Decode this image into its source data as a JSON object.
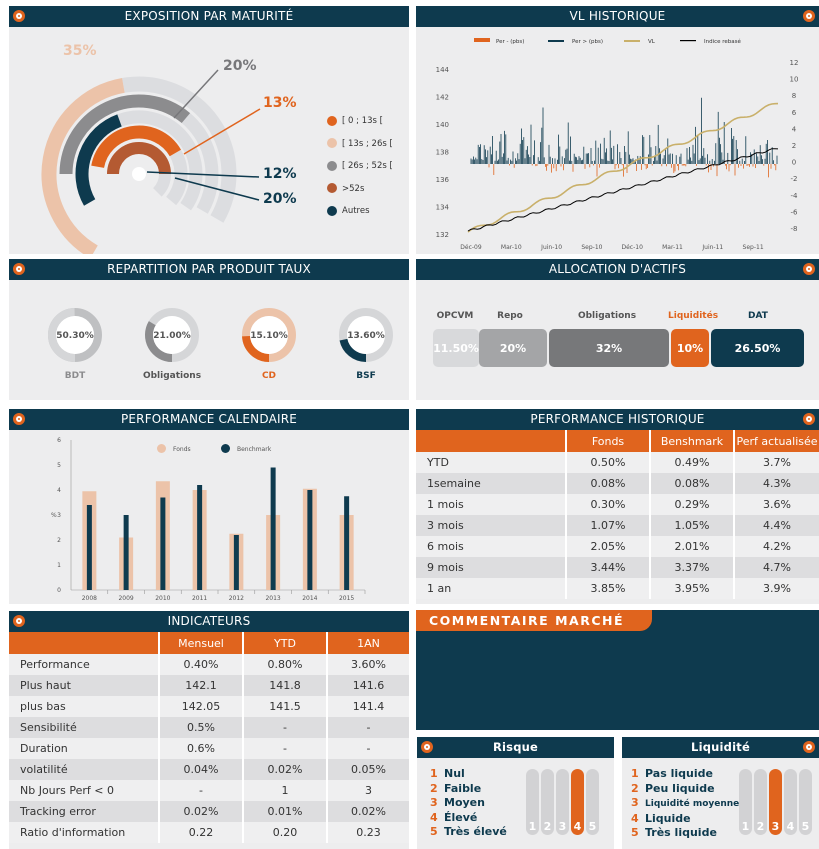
{
  "colors": {
    "navy": "#0e3a4e",
    "orange": "#e0641e",
    "peach": "#ecc3a9",
    "gray": "#8c8c8e",
    "lightgray": "#d5d6d8",
    "brown": "#b45a32"
  },
  "maturite": {
    "title": "EXPOSITION PAR MATURITÉ",
    "labels": [
      "35%",
      "20%",
      "13%",
      "12%",
      "20%"
    ],
    "legend": [
      "[ 0 ; 13s [",
      "[ 13s ; 26s [",
      "[ 26s ; 52s [",
      ">52s",
      "Autres"
    ]
  },
  "vl": {
    "title": "VL HISTORIQUE",
    "legend": [
      "Per - (pbs)",
      "Per > (pbs)",
      "VL",
      "Indice rebasé"
    ],
    "left_ticks": [
      "144",
      "142",
      "140",
      "138",
      "136",
      "134",
      "132"
    ],
    "right_ticks": [
      "12",
      "10",
      "8",
      "6",
      "4",
      "2",
      "0",
      "-2",
      "-4",
      "-6",
      "-8"
    ],
    "x_ticks": [
      "Déc-09",
      "Mar-10",
      "Juin-10",
      "Sep-10",
      "Déc-10",
      "Mar-11",
      "Juin-11",
      "Sep-11"
    ]
  },
  "repartition": {
    "title": "REPARTITION PAR PRODUIT TAUX",
    "items": [
      {
        "value": "50.30%",
        "label": "BDT",
        "pct": 50.3
      },
      {
        "value": "21.00%",
        "label": "Obligations",
        "pct": 21.0
      },
      {
        "value": "15.10%",
        "label": "CD",
        "pct": 15.1
      },
      {
        "value": "13.60%",
        "label": "BSF",
        "pct": 13.6
      }
    ]
  },
  "allocation": {
    "title": "ALLOCATION D'ACTIFS",
    "items": [
      {
        "label": "OPCVM",
        "value": "11.50%"
      },
      {
        "label": "Repo",
        "value": "20%"
      },
      {
        "label": "Obligations",
        "value": "32%"
      },
      {
        "label": "Liquidités",
        "value": "10%"
      },
      {
        "label": "DAT",
        "value": "26.50%"
      }
    ]
  },
  "perf_cal": {
    "title": "PERFORMANCE CALENDAIRE",
    "legend": [
      "Fonds",
      "Benchmark"
    ],
    "ylabel": "%"
  },
  "chart_data": {
    "type": "bar",
    "categories": [
      "2008",
      "2009",
      "2010",
      "2011",
      "2012",
      "2013",
      "2014",
      "2015"
    ],
    "series": [
      {
        "name": "Fonds",
        "values": [
          3.95,
          2.1,
          4.35,
          4.0,
          2.25,
          3.0,
          4.05,
          3.0
        ]
      },
      {
        "name": "Benchmark",
        "values": [
          3.4,
          3.0,
          3.7,
          4.2,
          2.2,
          4.9,
          4.0,
          3.75
        ]
      }
    ],
    "ylim": [
      0,
      6
    ],
    "yticks": [
      "0",
      "1",
      "2",
      "3",
      "4",
      "5",
      "6"
    ]
  },
  "perf_hist": {
    "title": "PERFORMANCE HISTORIQUE",
    "headers": [
      "",
      "Fonds",
      "Benshmark",
      "Perf actualisée"
    ],
    "rows": [
      [
        "YTD",
        "0.50%",
        "0.49%",
        "3.7%"
      ],
      [
        "1semaine",
        "0.08%",
        "0.08%",
        "4.3%"
      ],
      [
        "1 mois",
        "0.30%",
        "0.29%",
        "3.6%"
      ],
      [
        "3 mois",
        "1.07%",
        "1.05%",
        "4.4%"
      ],
      [
        "6 mois",
        "2.05%",
        "2.01%",
        "4.2%"
      ],
      [
        "9 mois",
        "3.44%",
        "3.37%",
        "4.7%"
      ],
      [
        "1 an",
        "3.85%",
        "3.95%",
        "3.9%"
      ]
    ]
  },
  "indicateurs": {
    "title": "INDICATEURS",
    "headers": [
      "",
      "Mensuel",
      "YTD",
      "1AN"
    ],
    "rows": [
      [
        "Performance",
        "0.40%",
        "0.80%",
        "3.60%"
      ],
      [
        "Plus haut",
        "142.1",
        "141.8",
        "141.6"
      ],
      [
        "plus bas",
        "142.05",
        "141.5",
        "141.4"
      ],
      [
        "Sensibilité",
        "0.5%",
        "-",
        "-"
      ],
      [
        "Duration",
        "0.6%",
        "-",
        "-"
      ],
      [
        "volatilité",
        "0.04%",
        "0.02%",
        "0.05%"
      ],
      [
        "Nb Jours Perf < 0",
        "-",
        "1",
        "3"
      ],
      [
        "Tracking error",
        "0.02%",
        "0.01%",
        "0.02%"
      ],
      [
        "Ratio d'information",
        "0.22",
        "0.20",
        "0.23"
      ]
    ]
  },
  "commentaire": {
    "title": "COMMENTAIRE MARCHÉ"
  },
  "risque": {
    "title": "Risque",
    "items": [
      "Nul",
      "Faible",
      "Moyen",
      "Élevé",
      "Très élevé"
    ],
    "numbers": [
      "1",
      "2",
      "3",
      "4",
      "5"
    ],
    "level": 4
  },
  "liquidite": {
    "title": "Liquidité",
    "items": [
      "Pas liquide",
      "Peu liquide",
      "Liquidité moyenne",
      "Liquide",
      "Très liquide"
    ],
    "numbers": [
      "1",
      "2",
      "3",
      "4",
      "5"
    ],
    "level": 3
  }
}
